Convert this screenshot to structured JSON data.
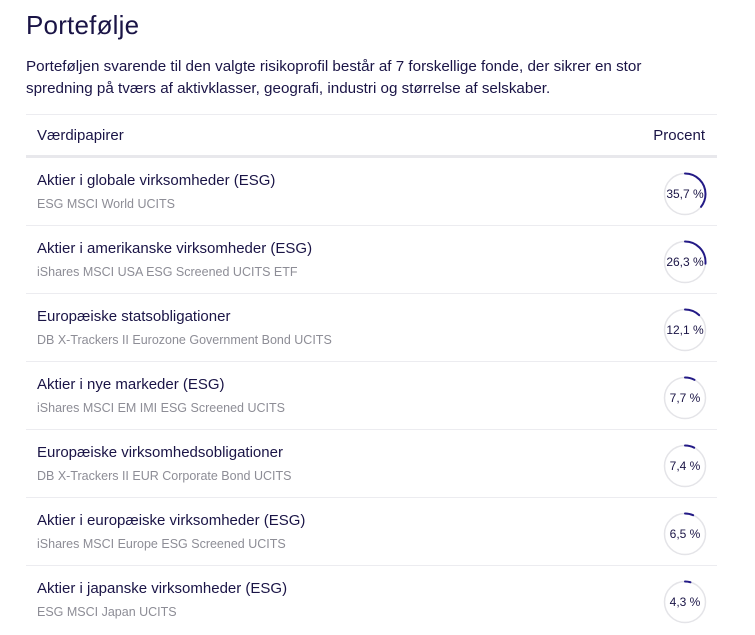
{
  "page": {
    "title": "Portefølje",
    "intro": "Porteføljen svarende til den valgte risikoprofil består af 7 forskellige fonde, der sikrer en stor spredning på tværs af aktivklasser, geografi, industri og størrelse af selskaber."
  },
  "table": {
    "headers": {
      "securities": "Værdipapirer",
      "percent": "Procent"
    },
    "rows": [
      {
        "name": "Aktier i globale virksomheder (ESG)",
        "fund": "ESG MSCI World UCITS",
        "percent_label": "35,7 %",
        "percent": 35.7
      },
      {
        "name": "Aktier i amerikanske virksomheder (ESG)",
        "fund": "iShares MSCI USA ESG Screened UCITS ETF",
        "percent_label": "26,3 %",
        "percent": 26.3
      },
      {
        "name": "Europæiske statsobligationer",
        "fund": "DB X-Trackers II Eurozone Government Bond UCITS",
        "percent_label": "12,1 %",
        "percent": 12.1
      },
      {
        "name": "Aktier i nye markeder (ESG)",
        "fund": "iShares MSCI EM IMI ESG Screened UCITS",
        "percent_label": "7,7 %",
        "percent": 7.7
      },
      {
        "name": "Europæiske virksomhedsobligationer",
        "fund": "DB X-Trackers II EUR Corporate Bond UCITS",
        "percent_label": "7,4 %",
        "percent": 7.4
      },
      {
        "name": "Aktier i europæiske virksomheder (ESG)",
        "fund": "iShares MSCI Europe ESG Screened UCITS",
        "percent_label": "6,5 %",
        "percent": 6.5
      },
      {
        "name": "Aktier i japanske virksomheder (ESG)",
        "fund": "ESG MSCI Japan UCITS",
        "percent_label": "4,3 %",
        "percent": 4.3
      }
    ]
  },
  "colors": {
    "accent": "#231a86",
    "ring_track": "#e4e4e8",
    "text_primary": "#1a1446",
    "text_secondary": "#8d8d96"
  }
}
